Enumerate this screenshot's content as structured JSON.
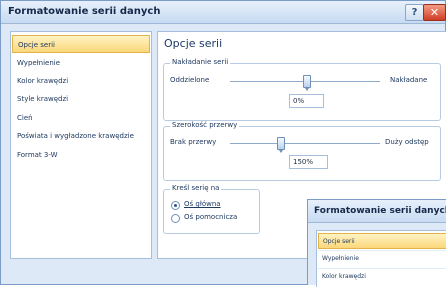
{
  "dialog": {
    "title": "Formatowanie serii danych",
    "help_label": "?",
    "close_label": "✕"
  },
  "sidebar": {
    "items": [
      {
        "label": "Opcje serii",
        "selected": true
      },
      {
        "label": "Wypełnienie"
      },
      {
        "label": "Kolor krawędzi"
      },
      {
        "label": "Style krawędzi"
      },
      {
        "label": "Cień"
      },
      {
        "label": "Poświata i wygładzone krawędzie"
      },
      {
        "label": "Format 3-W"
      }
    ]
  },
  "main": {
    "heading": "Opcje serii",
    "overlap": {
      "group_title": "Nakładanie serii",
      "left_label": "Oddzielone",
      "right_label": "Nakładane",
      "value": "0%"
    },
    "gap": {
      "group_title": "Szerokość przerwy",
      "left_label": "Brak przerwy",
      "right_label": "Duży odstęp",
      "value": "150%"
    },
    "axis": {
      "group_title": "Kreśl serię na",
      "primary_label": "Oś główna",
      "secondary_label": "Oś pomocnicza",
      "selected": "primary"
    }
  },
  "overlay_dialog": {
    "title": "Formatowanie serii danych",
    "items": [
      {
        "label": "Opcje serii",
        "selected": true
      },
      {
        "label": "Wypełnienie"
      },
      {
        "label": "Kolor krawędzi"
      }
    ]
  },
  "colors": {
    "accent": "#fbd77a",
    "frame": "#dde9f7",
    "border": "#7a9cc6",
    "close": "#cf3f24"
  }
}
